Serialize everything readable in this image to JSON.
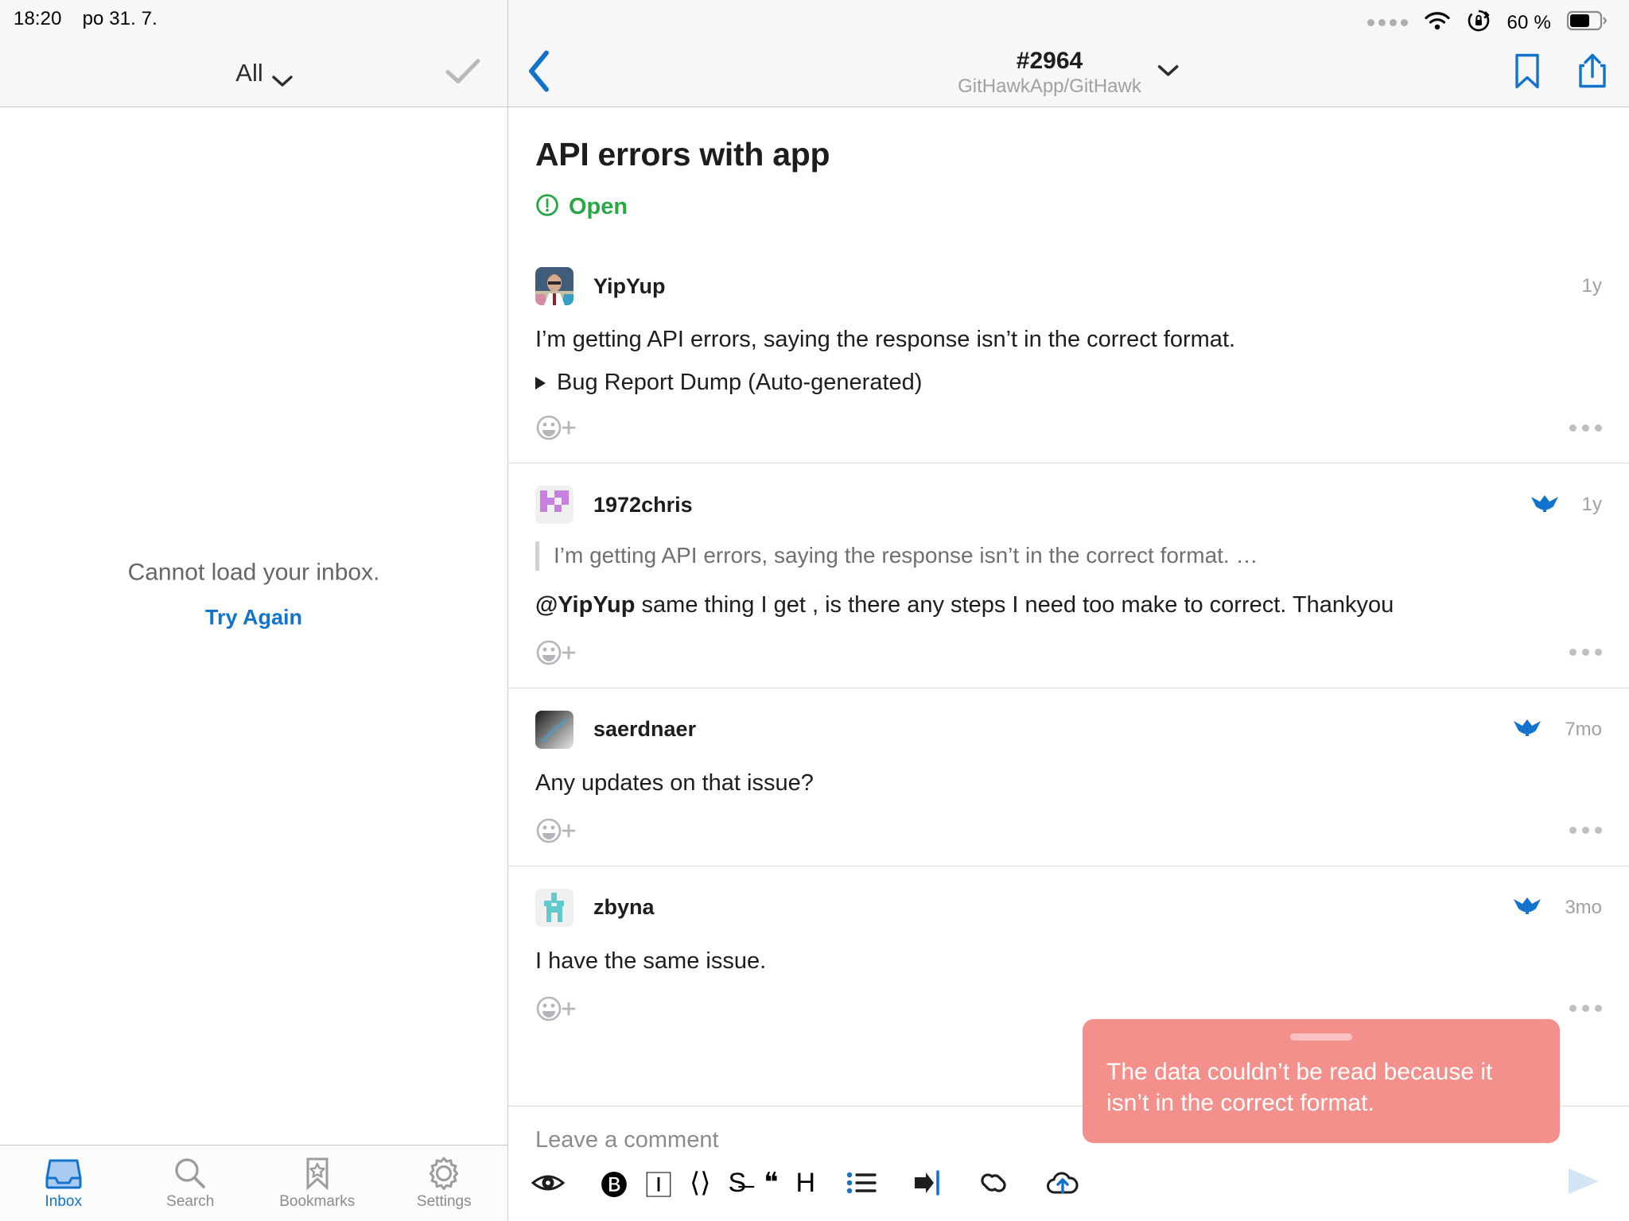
{
  "status_bar": {
    "time": "18:20",
    "date": "po 31. 7.",
    "battery_percent": "60 %",
    "wifi_icon": "wifi-icon",
    "rotation_lock_icon": "rotation-lock-icon",
    "signal_icon": "signal-dots-icon",
    "battery_icon": "battery-icon"
  },
  "sidebar": {
    "filter_label": "All",
    "filter_chevron_icon": "chevron-down-icon",
    "mark_read_icon": "checkmark-icon",
    "empty_state": {
      "message": "Cannot load your inbox.",
      "action_label": "Try Again"
    },
    "tabs": [
      {
        "label": "Inbox",
        "icon": "inbox-icon",
        "active": true
      },
      {
        "label": "Search",
        "icon": "search-icon",
        "active": false
      },
      {
        "label": "Bookmarks",
        "icon": "bookmark-icon",
        "active": false
      },
      {
        "label": "Settings",
        "icon": "gear-icon",
        "active": false
      }
    ]
  },
  "nav": {
    "back_icon": "chevron-left-icon",
    "title": "#2964",
    "subtitle": "GitHawkApp/GitHawk",
    "title_chevron_icon": "chevron-down-icon",
    "bookmark_icon": "bookmark-icon",
    "share_icon": "share-icon"
  },
  "issue": {
    "title": "API errors with app",
    "state_label": "Open",
    "state_icon": "exclamation-circle-icon",
    "state_color": "#28a745"
  },
  "comments": [
    {
      "author": "YipYup",
      "time": "1y",
      "avatar": "photo-avatar",
      "avatar_type": "photo",
      "body": "I’m getting API errors, saying the response isn’t in the correct format.",
      "disclosure_label": "Bug Report Dump (Auto-generated)",
      "disclosure_icon": "triangle-right-icon",
      "quote": null,
      "badge_icon": null,
      "react_icon": "add-reaction-icon",
      "more_icon": "more-horizontal-icon"
    },
    {
      "author": "1972chris",
      "time": "1y",
      "avatar": "identicon-purple",
      "avatar_type": "identicon",
      "quote": "I’m getting API errors, saying the response isn’t in the correct format. …",
      "mention": "@YipYup",
      "body": " same thing I get , is there any steps I need too make to correct. Thankyou",
      "badge_icon": "hawk-icon",
      "react_icon": "add-reaction-icon",
      "more_icon": "more-horizontal-icon"
    },
    {
      "author": "saerdnaer",
      "time": "7mo",
      "avatar": "gradient-avatar",
      "avatar_type": "gradient",
      "body": "Any updates on that issue?",
      "quote": null,
      "badge_icon": "hawk-icon",
      "react_icon": "add-reaction-icon",
      "more_icon": "more-horizontal-icon"
    },
    {
      "author": "zbyna",
      "time": "3mo",
      "avatar": "identicon-teal",
      "avatar_type": "identicon",
      "body": "I have the same issue.",
      "quote": null,
      "badge_icon": "hawk-icon",
      "react_icon": "add-reaction-icon",
      "more_icon": "more-horizontal-icon"
    }
  ],
  "composer": {
    "placeholder": "Leave a comment",
    "toolbar": [
      {
        "icon": "eye-preview-icon"
      },
      {
        "icon": "bold-icon"
      },
      {
        "icon": "italic-icon"
      },
      {
        "icon": "code-icon"
      },
      {
        "icon": "strikethrough-icon"
      },
      {
        "icon": "quote-icon"
      },
      {
        "icon": "heading-icon"
      },
      {
        "icon": "bullet-list-icon"
      },
      {
        "icon": "indent-icon"
      },
      {
        "icon": "link-icon"
      },
      {
        "icon": "upload-image-icon"
      }
    ],
    "send_icon": "send-icon"
  },
  "toast": {
    "message": "The data couldn’t be read because it isn’t in the correct format.",
    "background_color": "#f4908c",
    "grip_icon": "drag-handle-icon"
  },
  "colors": {
    "accent": "#1273cc",
    "open_green": "#28a745",
    "error": "#f4908c"
  }
}
